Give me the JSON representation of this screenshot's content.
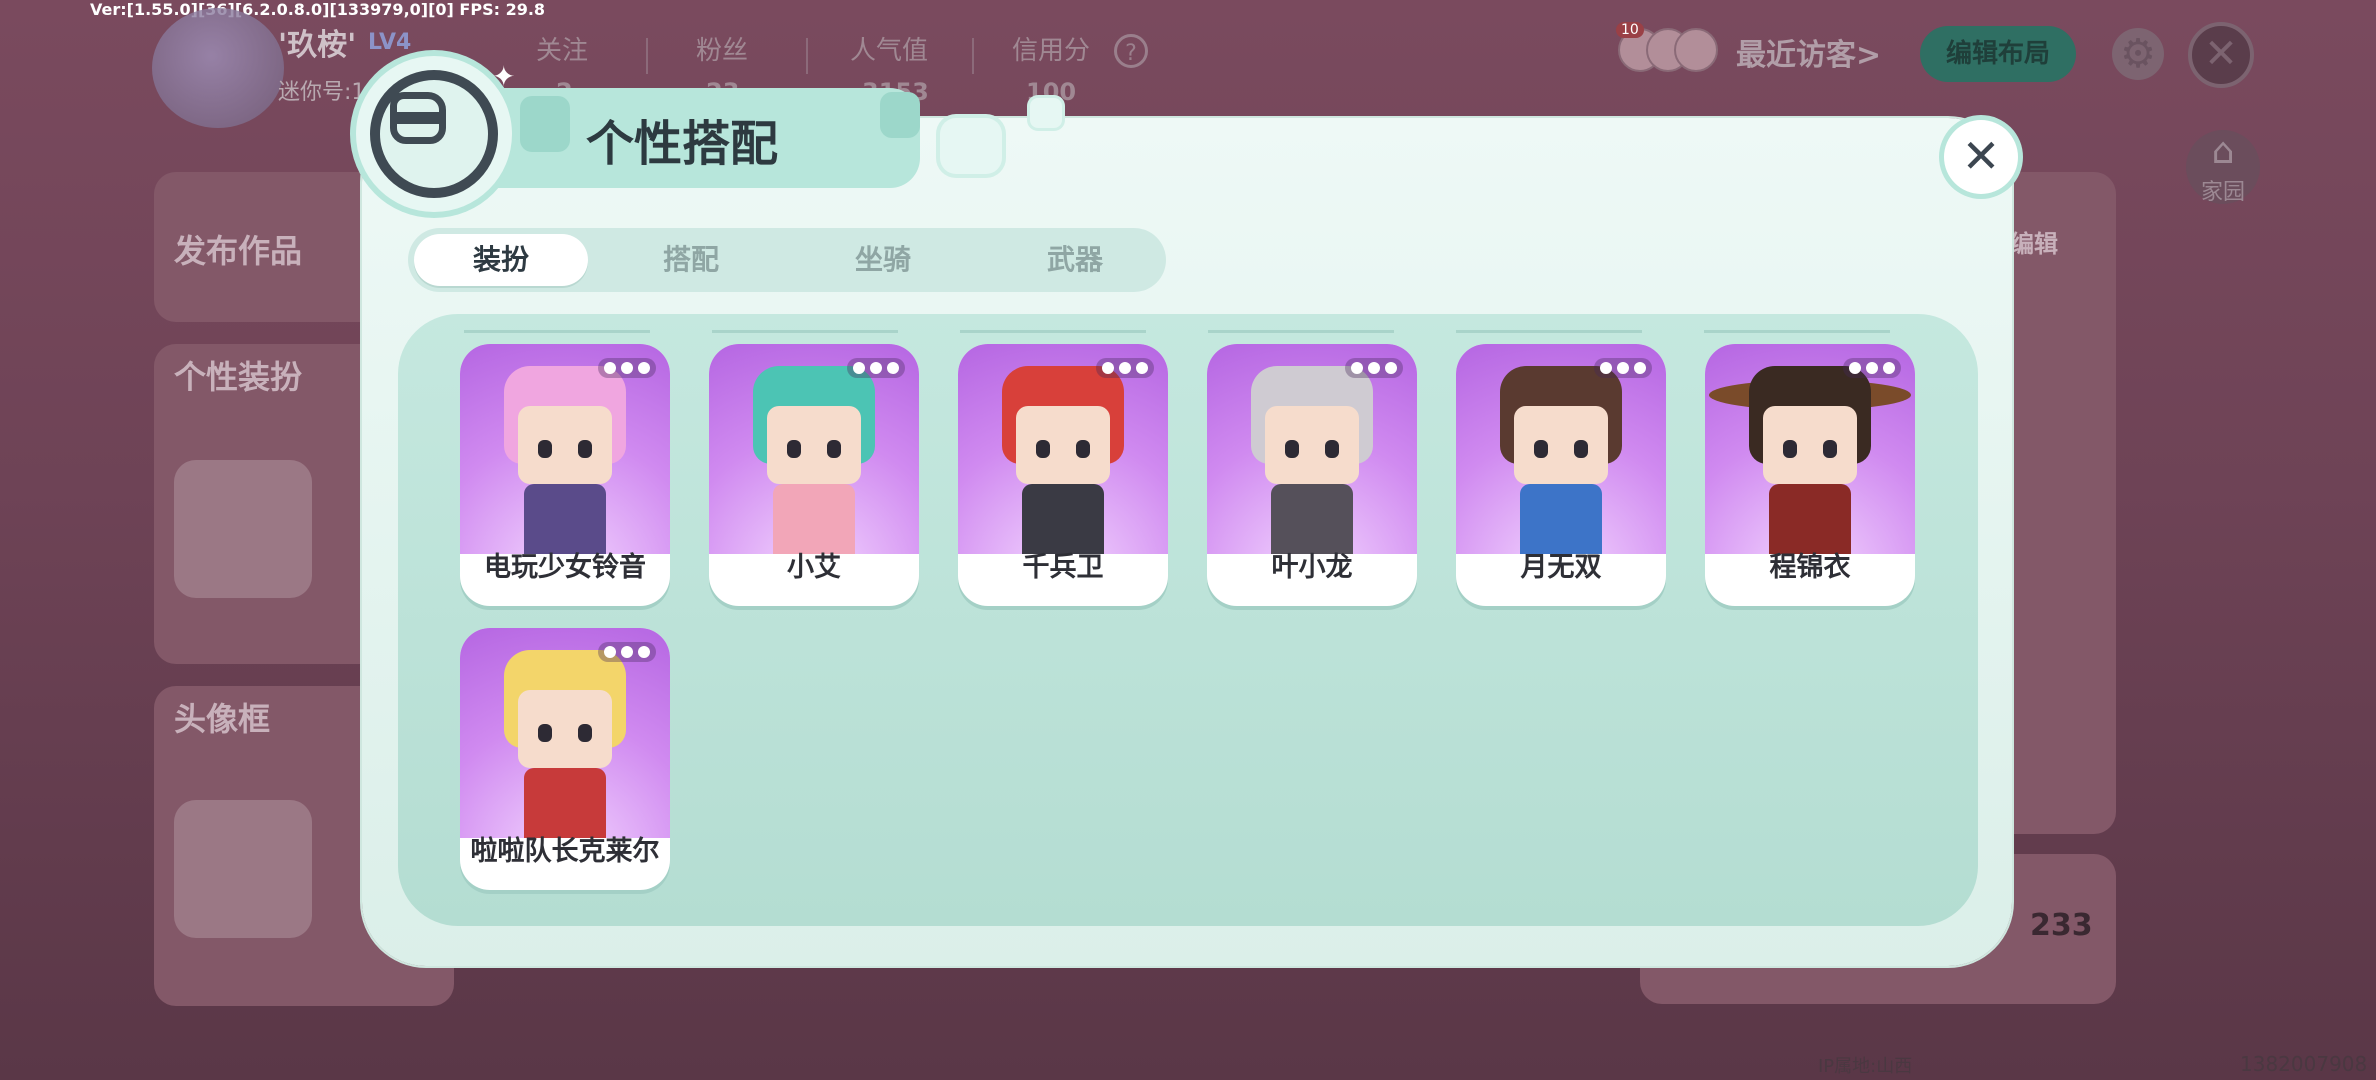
{
  "debug": "Ver:[1.55.0][36][6.2.0.8.0][133979,0][0] FPS: 29.8",
  "profile": {
    "nickname": "'玖桉'",
    "level": "LV4",
    "mini_id_label": "迷你号:1",
    "stats": [
      {
        "label": "关注",
        "value": "2"
      },
      {
        "label": "粉丝",
        "value": "23"
      },
      {
        "label": "人气值",
        "value": "3153"
      },
      {
        "label": "信用分",
        "value": "100"
      }
    ],
    "help_icon": "?",
    "visitor_badge": "10",
    "recent_visitors": "最近访客>",
    "edit_layout": "编辑布局",
    "home_label": "家园",
    "sections": {
      "publish": "发布作品",
      "outfit": "个性装扮",
      "frame": "头像框"
    },
    "edit_corner": "编辑",
    "count": "233",
    "footer_left": "IP属地:山西",
    "footer_right": "1382007908"
  },
  "modal": {
    "title": "个性搭配",
    "close_glyph": "✕",
    "tabs": [
      {
        "label": "装扮",
        "active": true
      },
      {
        "label": "搭配",
        "active": false
      },
      {
        "label": "坐骑",
        "active": false
      },
      {
        "label": "武器",
        "active": false
      }
    ],
    "items": [
      {
        "name": "电玩少女铃音",
        "hair": "#f0a6e0",
        "body": "#5a4b8a"
      },
      {
        "name": "小艾",
        "hair": "#4cc4b4",
        "body": "#f2a6b8"
      },
      {
        "name": "千兵卫",
        "hair": "#d8403a",
        "body": "#3a3a44"
      },
      {
        "name": "叶小龙",
        "hair": "#cfcbd2",
        "body": "#55505a"
      },
      {
        "name": "月无双",
        "hair": "#5a3a30",
        "body": "#3d74c8"
      },
      {
        "name": "程锦衣",
        "hair": "#3a2a22",
        "body": "#8a2a26"
      },
      {
        "name": "啦啦队长克莱尔",
        "hair": "#f3d56a",
        "body": "#c73a3a"
      }
    ]
  }
}
